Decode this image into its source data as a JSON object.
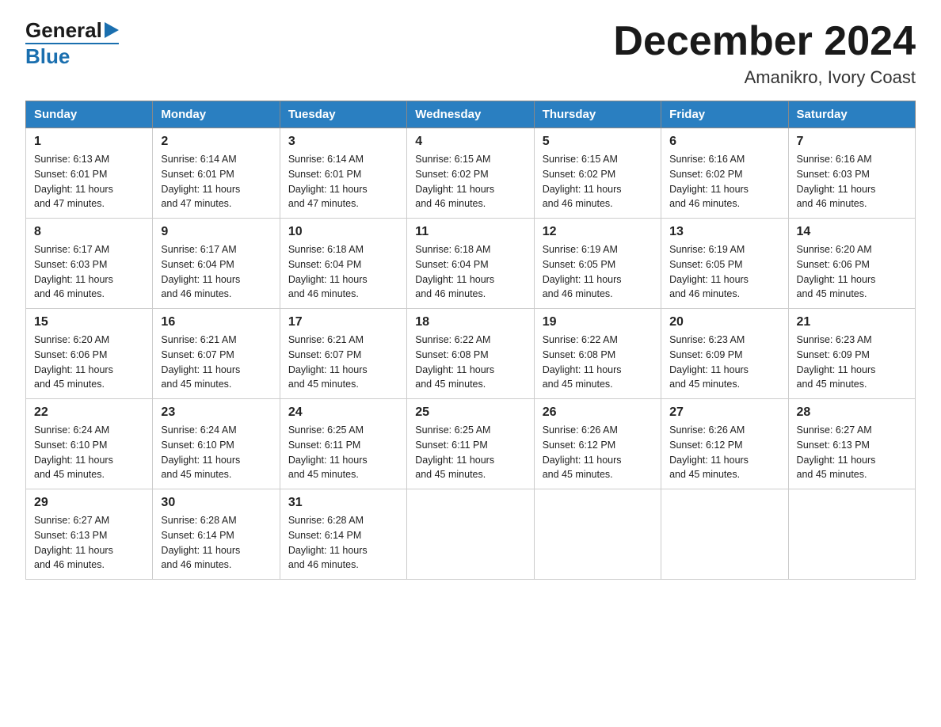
{
  "logo": {
    "general": "General",
    "blue": "Blue"
  },
  "title": {
    "month_year": "December 2024",
    "location": "Amanikro, Ivory Coast"
  },
  "headers": [
    "Sunday",
    "Monday",
    "Tuesday",
    "Wednesday",
    "Thursday",
    "Friday",
    "Saturday"
  ],
  "weeks": [
    [
      {
        "day": "1",
        "sunrise": "6:13 AM",
        "sunset": "6:01 PM",
        "daylight": "11 hours and 47 minutes."
      },
      {
        "day": "2",
        "sunrise": "6:14 AM",
        "sunset": "6:01 PM",
        "daylight": "11 hours and 47 minutes."
      },
      {
        "day": "3",
        "sunrise": "6:14 AM",
        "sunset": "6:01 PM",
        "daylight": "11 hours and 47 minutes."
      },
      {
        "day": "4",
        "sunrise": "6:15 AM",
        "sunset": "6:02 PM",
        "daylight": "11 hours and 46 minutes."
      },
      {
        "day": "5",
        "sunrise": "6:15 AM",
        "sunset": "6:02 PM",
        "daylight": "11 hours and 46 minutes."
      },
      {
        "day": "6",
        "sunrise": "6:16 AM",
        "sunset": "6:02 PM",
        "daylight": "11 hours and 46 minutes."
      },
      {
        "day": "7",
        "sunrise": "6:16 AM",
        "sunset": "6:03 PM",
        "daylight": "11 hours and 46 minutes."
      }
    ],
    [
      {
        "day": "8",
        "sunrise": "6:17 AM",
        "sunset": "6:03 PM",
        "daylight": "11 hours and 46 minutes."
      },
      {
        "day": "9",
        "sunrise": "6:17 AM",
        "sunset": "6:04 PM",
        "daylight": "11 hours and 46 minutes."
      },
      {
        "day": "10",
        "sunrise": "6:18 AM",
        "sunset": "6:04 PM",
        "daylight": "11 hours and 46 minutes."
      },
      {
        "day": "11",
        "sunrise": "6:18 AM",
        "sunset": "6:04 PM",
        "daylight": "11 hours and 46 minutes."
      },
      {
        "day": "12",
        "sunrise": "6:19 AM",
        "sunset": "6:05 PM",
        "daylight": "11 hours and 46 minutes."
      },
      {
        "day": "13",
        "sunrise": "6:19 AM",
        "sunset": "6:05 PM",
        "daylight": "11 hours and 46 minutes."
      },
      {
        "day": "14",
        "sunrise": "6:20 AM",
        "sunset": "6:06 PM",
        "daylight": "11 hours and 45 minutes."
      }
    ],
    [
      {
        "day": "15",
        "sunrise": "6:20 AM",
        "sunset": "6:06 PM",
        "daylight": "11 hours and 45 minutes."
      },
      {
        "day": "16",
        "sunrise": "6:21 AM",
        "sunset": "6:07 PM",
        "daylight": "11 hours and 45 minutes."
      },
      {
        "day": "17",
        "sunrise": "6:21 AM",
        "sunset": "6:07 PM",
        "daylight": "11 hours and 45 minutes."
      },
      {
        "day": "18",
        "sunrise": "6:22 AM",
        "sunset": "6:08 PM",
        "daylight": "11 hours and 45 minutes."
      },
      {
        "day": "19",
        "sunrise": "6:22 AM",
        "sunset": "6:08 PM",
        "daylight": "11 hours and 45 minutes."
      },
      {
        "day": "20",
        "sunrise": "6:23 AM",
        "sunset": "6:09 PM",
        "daylight": "11 hours and 45 minutes."
      },
      {
        "day": "21",
        "sunrise": "6:23 AM",
        "sunset": "6:09 PM",
        "daylight": "11 hours and 45 minutes."
      }
    ],
    [
      {
        "day": "22",
        "sunrise": "6:24 AM",
        "sunset": "6:10 PM",
        "daylight": "11 hours and 45 minutes."
      },
      {
        "day": "23",
        "sunrise": "6:24 AM",
        "sunset": "6:10 PM",
        "daylight": "11 hours and 45 minutes."
      },
      {
        "day": "24",
        "sunrise": "6:25 AM",
        "sunset": "6:11 PM",
        "daylight": "11 hours and 45 minutes."
      },
      {
        "day": "25",
        "sunrise": "6:25 AM",
        "sunset": "6:11 PM",
        "daylight": "11 hours and 45 minutes."
      },
      {
        "day": "26",
        "sunrise": "6:26 AM",
        "sunset": "6:12 PM",
        "daylight": "11 hours and 45 minutes."
      },
      {
        "day": "27",
        "sunrise": "6:26 AM",
        "sunset": "6:12 PM",
        "daylight": "11 hours and 45 minutes."
      },
      {
        "day": "28",
        "sunrise": "6:27 AM",
        "sunset": "6:13 PM",
        "daylight": "11 hours and 45 minutes."
      }
    ],
    [
      {
        "day": "29",
        "sunrise": "6:27 AM",
        "sunset": "6:13 PM",
        "daylight": "11 hours and 46 minutes."
      },
      {
        "day": "30",
        "sunrise": "6:28 AM",
        "sunset": "6:14 PM",
        "daylight": "11 hours and 46 minutes."
      },
      {
        "day": "31",
        "sunrise": "6:28 AM",
        "sunset": "6:14 PM",
        "daylight": "11 hours and 46 minutes."
      },
      null,
      null,
      null,
      null
    ]
  ],
  "labels": {
    "sunrise": "Sunrise:",
    "sunset": "Sunset:",
    "daylight": "Daylight:"
  }
}
